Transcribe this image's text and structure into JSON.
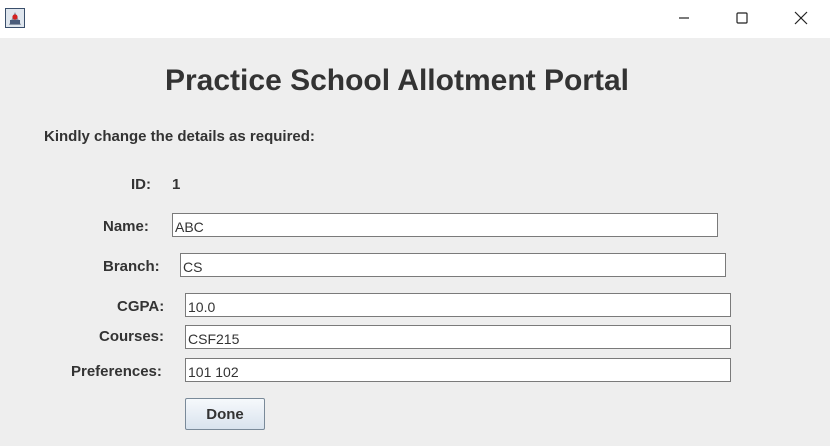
{
  "window": {
    "icons": {
      "app": "java-app-icon",
      "minimize": "minimize-icon",
      "maximize": "maximize-icon",
      "close": "close-icon"
    }
  },
  "portal": {
    "title": "Practice School Allotment Portal",
    "instruction": "Kindly change the details as required:"
  },
  "form": {
    "id_label": "ID:",
    "id_value": "1",
    "name_label": "Name:",
    "name_value": "ABC",
    "branch_label": "Branch:",
    "branch_value": "CS",
    "cgpa_label": "CGPA:",
    "cgpa_value": "10.0",
    "courses_label": "Courses:",
    "courses_value": "CSF215",
    "preferences_label": "Preferences:",
    "preferences_value": "101 102",
    "done_label": "Done"
  }
}
